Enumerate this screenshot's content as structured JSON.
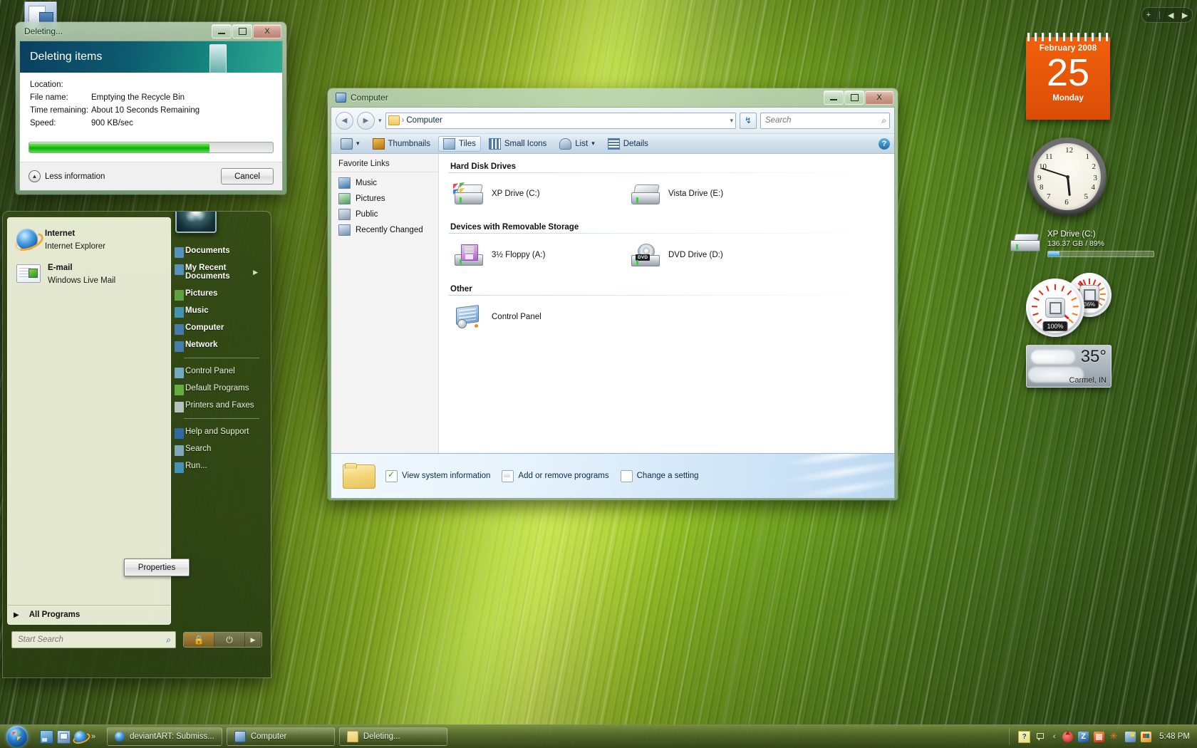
{
  "desktop": {
    "icon_label": "",
    "sidebar_controls": {
      "add": "+",
      "prev": "◀",
      "next": "▶"
    }
  },
  "deleting_dialog": {
    "title": "Deleting...",
    "header": "Deleting items",
    "rows": [
      {
        "label": "Location:",
        "value": ""
      },
      {
        "label": "File name:",
        "value": "Emptying the Recycle Bin"
      },
      {
        "label": "Time remaining:",
        "value": "About 10 Seconds Remaining"
      },
      {
        "label": "Speed:",
        "value": "900 KB/sec"
      }
    ],
    "progress_percent": 74,
    "less_information": "Less information",
    "cancel_label": "Cancel",
    "window_buttons": {
      "minimize": "minimize-icon",
      "maximize": "maximize-icon",
      "close": "X"
    }
  },
  "computer_window": {
    "title": "Computer",
    "address": {
      "path": "Computer",
      "dropdown": "▾",
      "refresh": "refresh-icon"
    },
    "search": {
      "placeholder": "Search",
      "value": ""
    },
    "toolbar": {
      "organize": "organize-icon",
      "views": [
        {
          "label": "Thumbnails",
          "icon": "thumbnails-icon",
          "active": false
        },
        {
          "label": "Tiles",
          "icon": "tiles-icon",
          "active": true
        },
        {
          "label": "Small Icons",
          "icon": "small-icons-icon",
          "active": false
        },
        {
          "label": "List",
          "icon": "list-icon",
          "active": false,
          "dropdown": "▾"
        },
        {
          "label": "Details",
          "icon": "details-icon",
          "active": false
        }
      ],
      "help": "?"
    },
    "favorite_links": {
      "title": "Favorite Links",
      "items": [
        {
          "label": "Music",
          "icon": "music-icon"
        },
        {
          "label": "Pictures",
          "icon": "pictures-icon"
        },
        {
          "label": "Public",
          "icon": "public-icon"
        },
        {
          "label": "Recently Changed",
          "icon": "recently-changed-icon"
        }
      ]
    },
    "groups": [
      {
        "heading": "Hard Disk Drives",
        "items": [
          {
            "label": "XP Drive (C:)",
            "icon": "xp-hard-drive-icon"
          },
          {
            "label": "Vista Drive (E:)",
            "icon": "hard-drive-icon"
          }
        ]
      },
      {
        "heading": "Devices with Removable Storage",
        "items": [
          {
            "label": "3½ Floppy (A:)",
            "icon": "floppy-drive-icon"
          },
          {
            "label": "DVD Drive (D:)",
            "icon": "dvd-drive-icon",
            "badge": "DVD"
          }
        ]
      },
      {
        "heading": "Other",
        "items": [
          {
            "label": "Control Panel",
            "icon": "control-panel-icon"
          }
        ]
      }
    ],
    "details_pane": {
      "folder_icon": "folder-icon",
      "links": [
        {
          "label": "View system information",
          "icon": "system-information-icon"
        },
        {
          "label": "Add or remove programs",
          "icon": "add-remove-programs-icon"
        },
        {
          "label": "Change a setting",
          "icon": "change-setting-icon"
        }
      ]
    },
    "window_buttons": {
      "minimize": "minimize-icon",
      "maximize": "maximize-icon",
      "close": "X"
    }
  },
  "start_menu": {
    "pinned": [
      {
        "title": "Internet",
        "subtitle": "Internet Explorer",
        "icon": "internet-explorer-icon"
      },
      {
        "title": "E-mail",
        "subtitle": "Windows Live Mail",
        "icon": "windows-live-mail-icon"
      }
    ],
    "all_programs": "All Programs",
    "all_programs_arrow": "▶",
    "search": {
      "placeholder": "Start Search",
      "value": "",
      "icon": "search-icon"
    },
    "right_items": [
      {
        "label": "Documents",
        "bold": true,
        "arrow": "",
        "separator_after": false
      },
      {
        "label": "My Recent Documents",
        "bold": true,
        "arrow": "▶",
        "separator_after": false
      },
      {
        "label": "Pictures",
        "bold": true,
        "arrow": "",
        "separator_after": false
      },
      {
        "label": "Music",
        "bold": true,
        "arrow": "",
        "separator_after": false
      },
      {
        "label": "Computer",
        "bold": true,
        "arrow": "",
        "separator_after": false
      },
      {
        "label": "Network",
        "bold": true,
        "arrow": "",
        "separator_after": true
      },
      {
        "label": "Control Panel",
        "bold": false,
        "arrow": "",
        "separator_after": false
      },
      {
        "label": "Default Programs",
        "bold": false,
        "arrow": "",
        "separator_after": false
      },
      {
        "label": "Printers and Faxes",
        "bold": false,
        "arrow": "",
        "separator_after": true
      },
      {
        "label": "Help and Support",
        "bold": false,
        "arrow": "",
        "separator_after": false
      },
      {
        "label": "Search",
        "bold": false,
        "arrow": "",
        "separator_after": false
      },
      {
        "label": "Run...",
        "bold": false,
        "arrow": "",
        "separator_after": false
      }
    ],
    "properties_button": "Properties",
    "power": {
      "lock": "lock-icon",
      "power": "power-icon",
      "arrow": "▶"
    }
  },
  "taskbar": {
    "start_orb": "windows-start-orb",
    "quick_launch": [
      {
        "name": "show-desktop-icon"
      },
      {
        "name": "switch-windows-icon"
      },
      {
        "name": "internet-explorer-icon"
      }
    ],
    "quick_launch_chevron": "»",
    "tasks": [
      {
        "label": "deviantART: Submiss...",
        "icon": "internet-explorer-icon"
      },
      {
        "label": "Computer",
        "icon": "computer-icon"
      },
      {
        "label": "Deleting...",
        "icon": "folder-icon"
      }
    ],
    "tray_icons": [
      "help-icon",
      "stacked-windows-icon",
      "left-arrow-icon",
      "mcafee-icon",
      "zonealarm-icon",
      "red-app-icon",
      "star-app-icon",
      "volume-icon",
      "paint-app-icon"
    ],
    "clock": "5:48 PM"
  },
  "gadgets": {
    "calendar": {
      "month_year": "February 2008",
      "day": "25",
      "weekday": "Monday"
    },
    "clock": {
      "hour_angle": 174,
      "minute_angle": 288,
      "numbers": [
        "12",
        "1",
        "2",
        "3",
        "4",
        "5",
        "6",
        "7",
        "8",
        "9",
        "10",
        "11"
      ]
    },
    "drive_meter": {
      "name": "XP Drive (C:)",
      "detail": "136.37 GB / 89%",
      "percent": 11
    },
    "cpu_meter": {
      "cpu_label": "100%",
      "cpu_percent": 100,
      "memory_label": "36%",
      "memory_percent": 36
    },
    "weather": {
      "temperature": "35°",
      "location": "Carmel, IN"
    }
  }
}
